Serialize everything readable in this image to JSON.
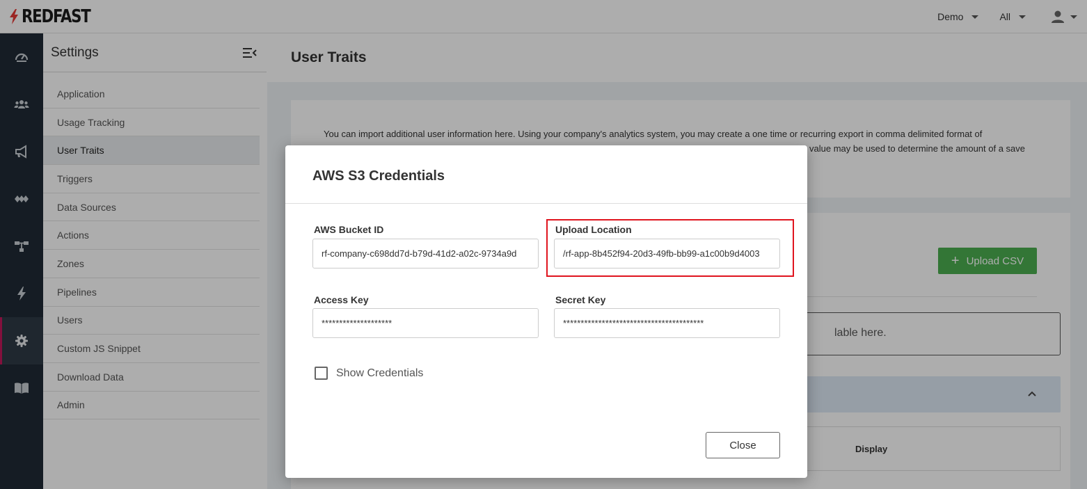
{
  "brand": {
    "name": "REDFAST",
    "accent": "#e53935"
  },
  "topbar": {
    "env_label": "Demo",
    "scope_label": "All"
  },
  "rail": {
    "items": [
      "dashboard-icon",
      "users-icon",
      "megaphone-icon",
      "pipelines-icon",
      "hierarchy-icon",
      "bolt-icon",
      "gear-icon",
      "book-icon"
    ],
    "active": "gear-icon",
    "active_color": "#c2185b"
  },
  "settings_nav": {
    "title": "Settings",
    "items": [
      {
        "label": "Application"
      },
      {
        "label": "Usage Tracking"
      },
      {
        "label": "User Traits"
      },
      {
        "label": "Triggers"
      },
      {
        "label": "Data Sources"
      },
      {
        "label": "Actions"
      },
      {
        "label": "Zones"
      },
      {
        "label": "Pipelines"
      },
      {
        "label": "Users"
      },
      {
        "label": "Custom JS Snippet"
      },
      {
        "label": "Download Data"
      },
      {
        "label": "Admin"
      }
    ],
    "active": "User Traits"
  },
  "main": {
    "title": "User Traits",
    "intro_line1": "You can import additional user information here. Using your company's analytics system, you may create a one time or recurring export in comma delimited format of",
    "intro_line2": "value may be used to determine the amount of a save",
    "upload_button": "Upload CSV",
    "info_text": "lable here.",
    "table_header_display": "Display"
  },
  "modal": {
    "title": "AWS S3 Credentials",
    "bucket_label": "AWS Bucket ID",
    "bucket_value": "rf-company-c698dd7d-b79d-41d2-a02c-9734a9d",
    "upload_label": "Upload Location",
    "upload_value": "/rf-app-8b452f94-20d3-49fb-bb99-a1c00b9d4003",
    "access_label": "Access Key",
    "access_value": "********************",
    "secret_label": "Secret Key",
    "secret_value": "****************************************",
    "show_credentials_label": "Show Credentials",
    "show_credentials_checked": false,
    "close_label": "Close",
    "highlight_color": "#e0141e"
  }
}
